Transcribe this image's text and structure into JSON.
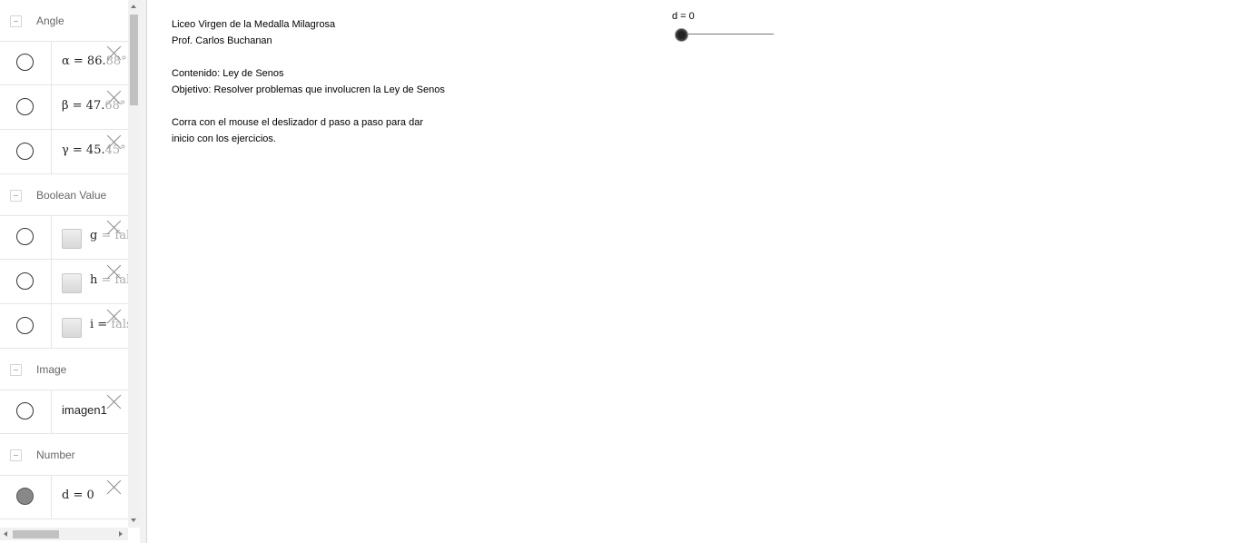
{
  "algebra": {
    "groups": [
      {
        "label": "Angle",
        "items": [
          {
            "main": "α = 86.",
            "fade": "88°"
          },
          {
            "main": "β = 47.",
            "fade": "68°"
          },
          {
            "main": "γ = 45.",
            "fade": "45°"
          }
        ]
      },
      {
        "label": "Boolean Value",
        "items": [
          {
            "main": "g ",
            "fade": "= fal"
          },
          {
            "main": "h ",
            "fade": "= fal"
          },
          {
            "main": "i = ",
            "fade": "fals"
          }
        ]
      },
      {
        "label": "Image",
        "items": [
          {
            "main": "imagen1",
            "fade": ""
          }
        ]
      },
      {
        "label": "Number",
        "items": [
          {
            "main": "d = 0",
            "fade": ""
          }
        ]
      }
    ]
  },
  "graphics": {
    "line1": "Liceo Virgen de la Medalla Milagrosa",
    "line2": "Prof. Carlos Buchanan",
    "line3": "Contenido: Ley de Senos",
    "line4": "Objetivo: Resolver problemas que involucren la Ley de Senos",
    "line5": "Corra con  el  mouse  el  deslizador  d   paso a paso para dar",
    "line6": "inicio con los ejercicios.",
    "slider_label": "d = 0",
    "slider_value": 0
  }
}
